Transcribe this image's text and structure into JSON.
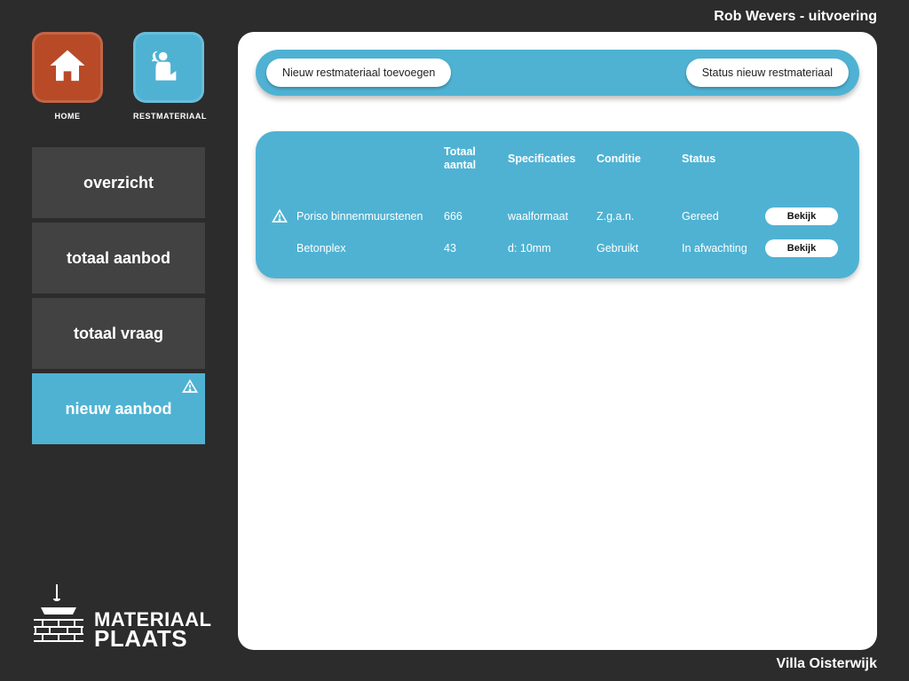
{
  "header": {
    "user_line": "Rob Wevers - uitvoering"
  },
  "footer": {
    "location": "Villa Oisterwijk"
  },
  "nav": {
    "home_label": "HOME",
    "rest_label": "RESTMATERIAAL"
  },
  "sidebar": {
    "items": [
      {
        "label": "overzicht",
        "active": false,
        "alert": false
      },
      {
        "label": "totaal aanbod",
        "active": false,
        "alert": false
      },
      {
        "label": "totaal vraag",
        "active": false,
        "alert": false
      },
      {
        "label": "nieuw aanbod",
        "active": true,
        "alert": true
      }
    ]
  },
  "toolbar": {
    "add_label": "Nieuw restmateriaal toevoegen",
    "status_label": "Status nieuw restmateriaal"
  },
  "table": {
    "headers": {
      "name": "",
      "total": "Totaal aantal",
      "specs": "Specificaties",
      "condition": "Conditie",
      "status": "Status",
      "action": ""
    },
    "rows": [
      {
        "alert": true,
        "name": "Poriso binnenmuurstenen",
        "total": "666",
        "specs": "waalformaat",
        "condition": "Z.g.a.n.",
        "status": "Gereed",
        "action": "Bekijk"
      },
      {
        "alert": false,
        "name": "Betonplex",
        "total": "43",
        "specs": "d: 10mm",
        "condition": "Gebruikt",
        "status": "In afwachting",
        "action": "Bekijk"
      }
    ]
  },
  "logo": {
    "line1": "MATERIAAL",
    "line2": "PLAATS"
  },
  "colors": {
    "accent": "#4fb2d3",
    "home_tile": "#b84a27",
    "panel": "#ffffff",
    "bg": "#2c2c2c"
  }
}
